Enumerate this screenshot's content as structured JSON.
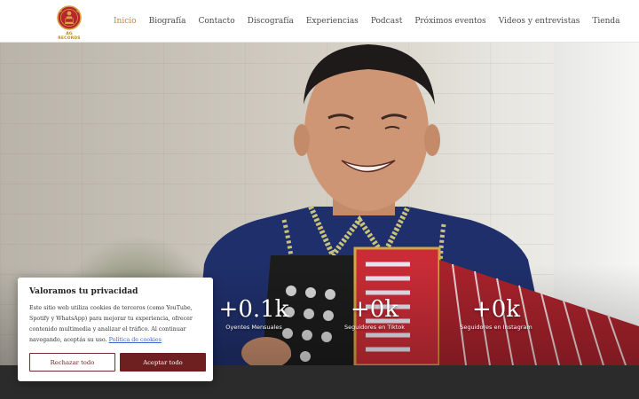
{
  "brand": {
    "logo_text": "AG RECORDS",
    "logo_icon": "accordion-player-emblem-icon",
    "primary_color": "#c9852f",
    "dark_red": "#6e1f1f"
  },
  "nav": {
    "items": [
      {
        "label": "Inicio",
        "active": true
      },
      {
        "label": "Biografía",
        "active": false
      },
      {
        "label": "Contacto",
        "active": false
      },
      {
        "label": "Discografía",
        "active": false
      },
      {
        "label": "Experiencias",
        "active": false
      },
      {
        "label": "Podcast",
        "active": false
      },
      {
        "label": "Próximos eventos",
        "active": false
      },
      {
        "label": "Videos y entrevistas",
        "active": false
      },
      {
        "label": "Tienda",
        "active": false
      }
    ]
  },
  "hero": {
    "image_description": "man-with-accordion",
    "stats": [
      {
        "value": "+0.1k",
        "label": "Oyentes Mensuales"
      },
      {
        "value": "+0k",
        "label": "Seguidores en Tiktok"
      },
      {
        "value": "+0k",
        "label": "Seguidores en Instagram"
      }
    ]
  },
  "cookie_banner": {
    "title": "Valoramos tu privacidad",
    "text": "Este sitio web utiliza cookies de terceros (como YouTube, Spotify y WhatsApp) para mejorar tu experiencia, ofrecer contenido multimedia y analizar el tráfico. Al continuar navegando, aceptás su uso.",
    "link_label": "Política de cookies",
    "reject_label": "Rechazar todo",
    "accept_label": "Aceptar todo"
  }
}
